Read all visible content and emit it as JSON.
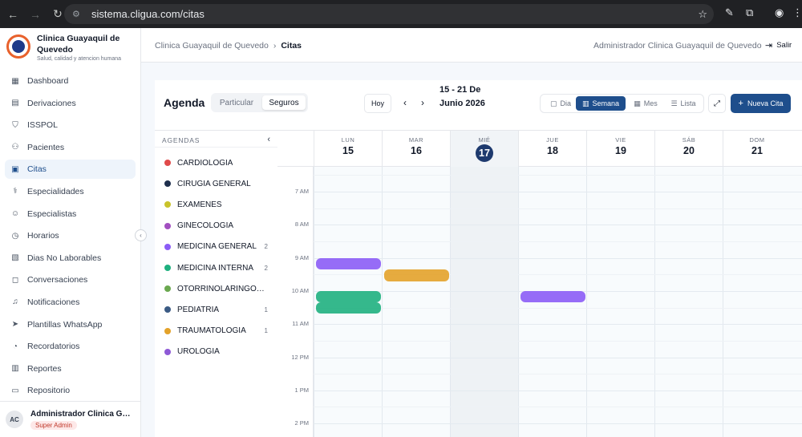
{
  "browser": {
    "url": "sistema.cligua.com/citas"
  },
  "sidebar": {
    "brand_name": "Clinica Guayaquil de Quevedo",
    "brand_tagline": "Salud, calidad y atencion humana",
    "items": [
      {
        "label": "Dashboard",
        "icon": "grid-icon"
      },
      {
        "label": "Derivaciones",
        "icon": "document-icon"
      },
      {
        "label": "ISSPOL",
        "icon": "shield-icon"
      },
      {
        "label": "Pacientes",
        "icon": "users-icon"
      },
      {
        "label": "Citas",
        "icon": "calendar-icon",
        "active": true
      },
      {
        "label": "Especialidades",
        "icon": "stethoscope-icon"
      },
      {
        "label": "Especialistas",
        "icon": "user-check-icon"
      },
      {
        "label": "Horarios",
        "icon": "clock-icon"
      },
      {
        "label": "Dias No Laborables",
        "icon": "calendar-off-icon"
      },
      {
        "label": "Conversaciones",
        "icon": "chat-icon"
      },
      {
        "label": "Notificaciones",
        "icon": "bell-icon"
      },
      {
        "label": "Plantillas WhatsApp",
        "icon": "send-icon"
      },
      {
        "label": "Recordatorios",
        "icon": "alarm-icon"
      },
      {
        "label": "Reportes",
        "icon": "bar-chart-icon"
      },
      {
        "label": "Repositorio",
        "icon": "folder-icon"
      }
    ],
    "user": {
      "initials": "AC",
      "name": "Administrador Clinica Guayaquil de Quevedo",
      "role": "Super Admin"
    }
  },
  "header": {
    "breadcrumb_root": "Clinica Guayaquil de Quevedo",
    "breadcrumb_sep": "›",
    "breadcrumb_current": "Citas",
    "user_name": "Administrador Clinica Guayaquil de Quevedo",
    "logout_label": "Salir"
  },
  "toolbar": {
    "title": "Agenda",
    "segment_particular": "Particular",
    "segment_seguros": "Seguros",
    "today_label": "Hoy",
    "prev_glyph": "‹",
    "next_glyph": "›",
    "range_label": "15 - 21 De Junio 2026",
    "view_dia": "Dia",
    "view_semana": "Semana",
    "view_mes": "Mes",
    "view_lista": "Lista",
    "new_label": "Nueva Cita",
    "accent_color": "#1e4e8c"
  },
  "agendas": {
    "header": "AGENDAS",
    "items": [
      {
        "name": "CARDIOLOGIA",
        "color": "#e04a4a",
        "count": ""
      },
      {
        "name": "CIRUGIA GENERAL",
        "color": "#1e2f4d",
        "count": ""
      },
      {
        "name": "EXAMENES",
        "color": "#c9c32b",
        "count": ""
      },
      {
        "name": "GINECOLOGIA",
        "color": "#a24fc0",
        "count": ""
      },
      {
        "name": "MEDICINA GENERAL",
        "color": "#8b5cf6",
        "count": "2"
      },
      {
        "name": "MEDICINA INTERNA",
        "color": "#1fb07f",
        "count": "2"
      },
      {
        "name": "OTORRINOLARINGOLOGIA",
        "color": "#6aa84f",
        "count": ""
      },
      {
        "name": "PEDIATRIA",
        "color": "#3b5b84",
        "count": "1"
      },
      {
        "name": "TRAUMATOLOGIA",
        "color": "#e3a22a",
        "count": "1"
      },
      {
        "name": "UROLOGIA",
        "color": "#8e59d6",
        "count": ""
      }
    ]
  },
  "calendar": {
    "days": [
      {
        "dow": "LUN",
        "num": "15"
      },
      {
        "dow": "MAR",
        "num": "16"
      },
      {
        "dow": "MIÉ",
        "num": "17",
        "today": true
      },
      {
        "dow": "JUE",
        "num": "18"
      },
      {
        "dow": "VIE",
        "num": "19"
      },
      {
        "dow": "SÁB",
        "num": "20"
      },
      {
        "dow": "DOM",
        "num": "21"
      }
    ],
    "hours": [
      "7 AM",
      "8 AM",
      "9 AM",
      "10 AM",
      "11 AM",
      "12 PM",
      "1 PM",
      "2 PM"
    ],
    "events": [
      {
        "day": 0,
        "start": 9.0,
        "end": 9.35,
        "color": "#8b5cf6"
      },
      {
        "day": 1,
        "start": 9.35,
        "end": 9.7,
        "color": "#e3a22a"
      },
      {
        "day": 0,
        "start": 10.0,
        "end": 10.35,
        "color": "#1fb07f"
      },
      {
        "day": 0,
        "start": 10.33,
        "end": 10.68,
        "color": "#1fb07f"
      },
      {
        "day": 3,
        "start": 10.0,
        "end": 10.35,
        "color": "#8b5cf6"
      }
    ]
  }
}
